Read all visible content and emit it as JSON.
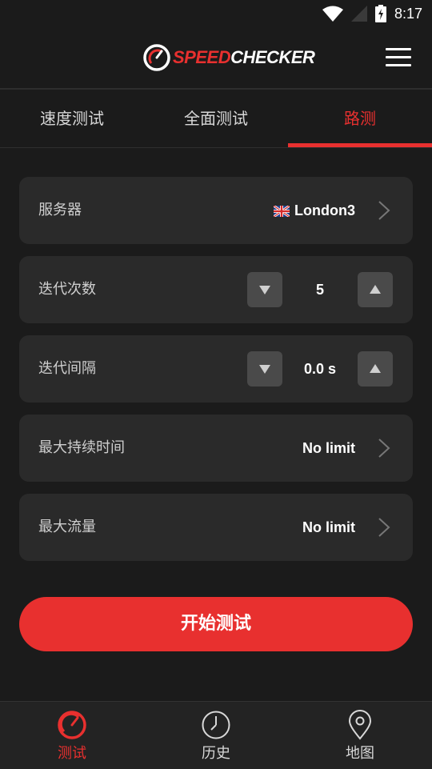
{
  "status": {
    "time": "8:17"
  },
  "app": {
    "logo_speed": "SPEED",
    "logo_checker": "CHECKER"
  },
  "tabs": [
    {
      "label": "速度测试"
    },
    {
      "label": "全面测试"
    },
    {
      "label": "路测",
      "active": true
    }
  ],
  "settings": {
    "server": {
      "label": "服务器",
      "value": "London3",
      "flag_icon": "uk-flag-icon"
    },
    "iterations": {
      "label": "迭代次数",
      "value": "5"
    },
    "interval": {
      "label": "迭代间隔",
      "value": "0.0 s"
    },
    "max_duration": {
      "label": "最大持续时间",
      "value": "No limit"
    },
    "max_traffic": {
      "label": "最大流量",
      "value": "No limit"
    }
  },
  "start_button": "开始测试",
  "bottom_nav": [
    {
      "label": "测试",
      "icon": "speedometer-icon",
      "active": true
    },
    {
      "label": "历史",
      "icon": "clock-icon"
    },
    {
      "label": "地图",
      "icon": "map-pin-icon"
    }
  ],
  "colors": {
    "accent": "#e8302f",
    "background": "#1b1b1b",
    "card": "#2a2a2a"
  }
}
